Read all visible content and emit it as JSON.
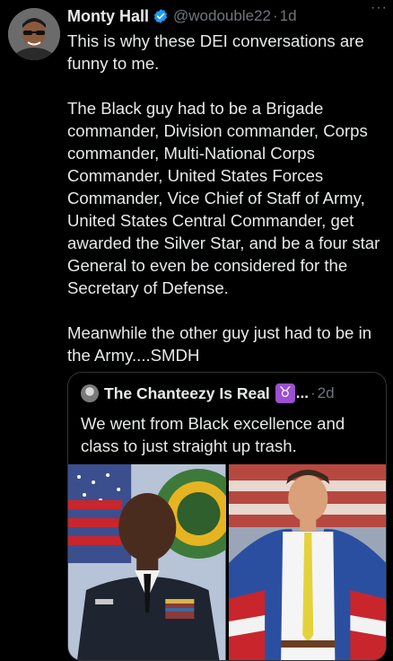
{
  "tweet": {
    "author_name": "Monty Hall",
    "handle": "@wodouble22",
    "separator": "·",
    "time": "1d",
    "more_label": "···",
    "verified_icon": "verified-badge-icon",
    "text": "This is why these DEI conversations are funny to me.\n\nThe Black guy had to be a Brigade commander, Division commander, Corps commander, Multi-National Corps Commander, United States Forces Commander, Vice Chief of Staff of Army, United States Central Commander, get awarded the Silver Star, and be a four star General to even be considered for the Secretary of Defense.\n\nMeanwhile the other guy just had to be in the Army....SMDH"
  },
  "quote": {
    "author_name": "The Chanteezy Is Real",
    "emoji": "♉",
    "ellipsis": "...",
    "separator": "·",
    "time": "2d",
    "text": "We went from Black excellence and class to just straight up trash.",
    "media": [
      {
        "name": "photo-military-officer"
      },
      {
        "name": "photo-man-with-flag-jacket"
      }
    ]
  },
  "colors": {
    "background": "#000000",
    "text": "#e7e9ea",
    "muted": "#71767b",
    "border": "#2f3336",
    "verified": "#1d9bf0"
  }
}
